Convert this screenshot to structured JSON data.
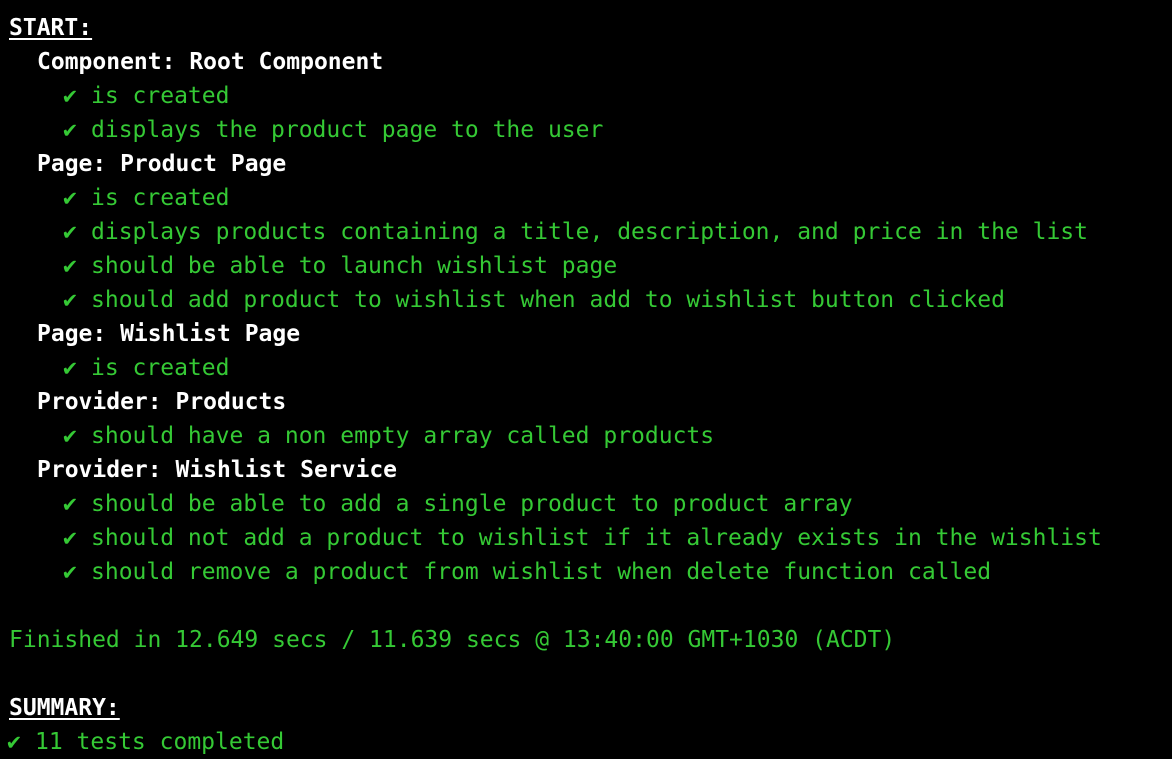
{
  "start_heading": "START:",
  "check_glyph": "✔",
  "suites": [
    {
      "title": "Component: Root Component",
      "tests": [
        "is created",
        "displays the product page to the user"
      ]
    },
    {
      "title": "Page: Product Page",
      "tests": [
        "is created",
        "displays products containing a title, description, and price in the list",
        "should be able to launch wishlist page",
        "should add product to wishlist when add to wishlist button clicked"
      ]
    },
    {
      "title": "Page: Wishlist Page",
      "tests": [
        "is created"
      ]
    },
    {
      "title": "Provider: Products",
      "tests": [
        "should have a non empty array called products"
      ]
    },
    {
      "title": "Provider: Wishlist Service",
      "tests": [
        "should be able to add a single product to product array",
        "should not add a product to wishlist if it already exists in the wishlist",
        "should remove a product from wishlist when delete function called"
      ]
    }
  ],
  "finished": "Finished in 12.649 secs / 11.639 secs @ 13:40:00 GMT+1030 (ACDT)",
  "summary_heading": "SUMMARY:",
  "summary_result": "11 tests completed",
  "colors": {
    "background": "#000000",
    "text": "#ffffff",
    "pass": "#35c935"
  }
}
